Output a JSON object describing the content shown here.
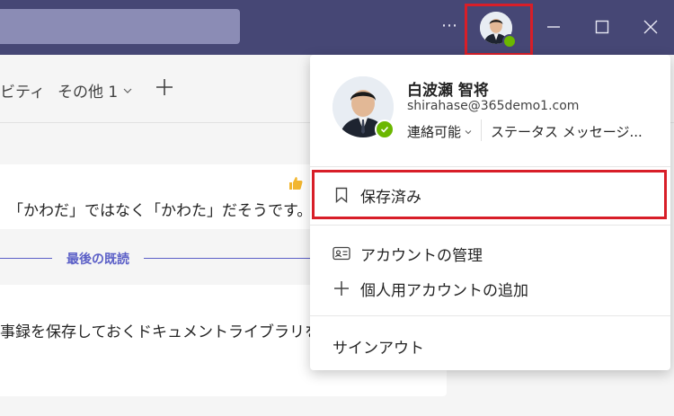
{
  "titlebar": {
    "more_label": "⋯",
    "icons": [
      "search-icon",
      "more-icon",
      "avatar",
      "minimize-icon",
      "maximize-icon",
      "close-icon"
    ]
  },
  "tabs": {
    "cut_tab_label": "ビティ",
    "more_tab_label": "その他 1",
    "add_tab_icon": "plus-icon"
  },
  "conversation": {
    "message1_text": "「かわだ」ではなく「かわた」だそうです。",
    "reaction_icon": "thumbs-up-icon",
    "last_read_label": "最後の既読",
    "message2_text": "事録を保存しておくドキュメントライブラリを"
  },
  "profile_menu": {
    "name": "白波瀬 智将",
    "email": "shirahase@365demo1.com",
    "status_label": "連絡可能",
    "status_message_label": "ステータス メッセージ...",
    "items": [
      {
        "label": "保存済み",
        "icon": "bookmark-icon"
      },
      {
        "label": "アカウントの管理",
        "icon": "id-card-icon"
      },
      {
        "label": "個人用アカウントの追加",
        "icon": "plus-icon"
      },
      {
        "label": "サインアウト",
        "icon": ""
      }
    ]
  },
  "colors": {
    "titlebar": "#464775",
    "accent": "#5b5fc7",
    "highlight": "#d81e28",
    "available": "#6bb700"
  }
}
